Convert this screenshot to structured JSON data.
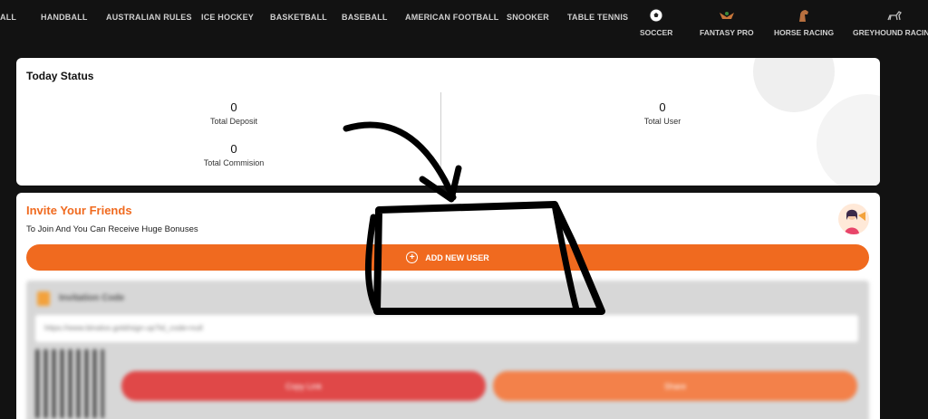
{
  "nav": {
    "text_items": [
      "ALL",
      "HANDBALL",
      "AUSTRALIAN RULES",
      "ICE HOCKEY",
      "BASKETBALL",
      "BASEBALL",
      "AMERICAN FOOTBALL",
      "SNOOKER",
      "TABLE TENNIS"
    ],
    "icon_items": [
      {
        "label": "SOCCER",
        "icon": "soccer-ball-icon"
      },
      {
        "label": "FANTASY PRO",
        "icon": "fantasy-pro-icon"
      },
      {
        "label": "HORSE RACING",
        "icon": "horse-icon"
      },
      {
        "label": "GREYHOUND RACING",
        "icon": "greyhound-icon"
      }
    ]
  },
  "status": {
    "title": "Today Status",
    "total_deposit": {
      "value": "0",
      "label": "Total Deposit"
    },
    "total_commission": {
      "value": "0",
      "label": "Total Commision"
    },
    "total_user": {
      "value": "0",
      "label": "Total User"
    }
  },
  "invite": {
    "title": "Invite Your Friends",
    "subtitle": "To Join And You Can Receive Huge Bonuses",
    "add_button": "ADD NEW USER",
    "code_label": "Invitation Code",
    "link_value": "https://www.binaloo.gold/sign-up?id_code=null",
    "copy_button": "Copy Link",
    "share_button": "Share"
  },
  "colors": {
    "accent": "#f06a1f",
    "background": "#121212",
    "copy": "#e04848",
    "share": "#f3814a"
  }
}
